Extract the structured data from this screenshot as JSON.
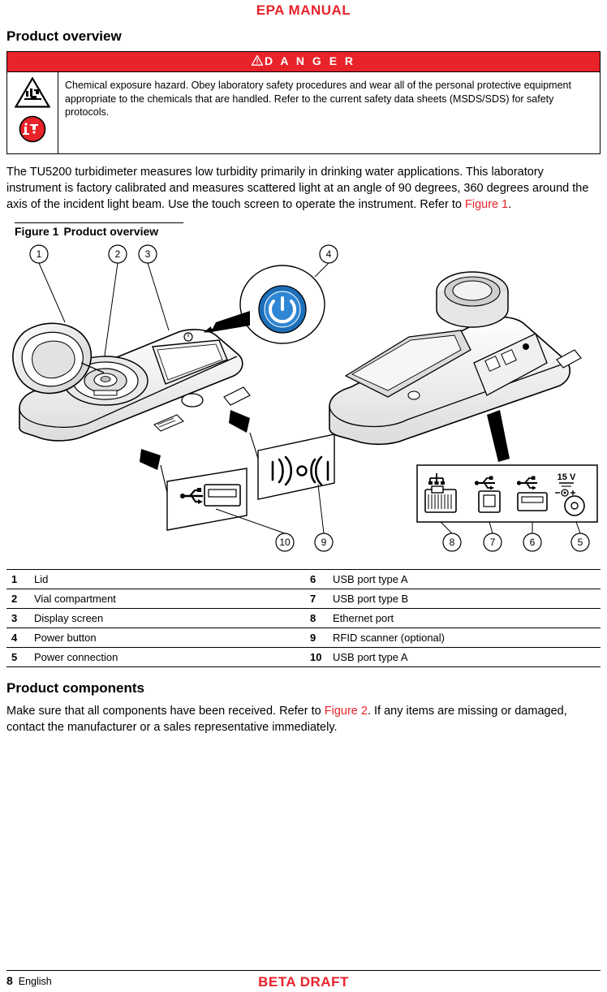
{
  "header": {
    "banner": "EPA MANUAL"
  },
  "footer": {
    "banner": "BETA DRAFT",
    "page_number": "8",
    "language": "English"
  },
  "sections": {
    "product_overview_title": "Product overview",
    "product_components_title": "Product components"
  },
  "danger": {
    "label": "D A N G E R",
    "warning_icon": "warning-triangle-icon",
    "hazard_icons": [
      "chemical-hazard-icon",
      "corrosive-hazard-icon"
    ],
    "text": "Chemical exposure hazard. Obey laboratory safety procedures and wear all of the personal protective equipment appropriate to the chemicals that are handled. Refer to the current safety data sheets (MSDS/SDS) for safety protocols."
  },
  "intro": {
    "part1": "The TU5200 turbidimeter measures low turbidity primarily in drinking water applications. This laboratory instrument is factory calibrated and measures scattered light at an angle of 90 degrees, 360 degrees around the axis of the incident light beam. Use the touch screen to operate the instrument. Refer to ",
    "xref": "Figure 1",
    "part2": "."
  },
  "figure": {
    "caption_num": "Figure 1",
    "caption_title": "Product overview",
    "callouts": [
      "1",
      "2",
      "3",
      "4",
      "5",
      "6",
      "7",
      "8",
      "9",
      "10"
    ],
    "connector_label": "15 V",
    "connector_polarity": "+"
  },
  "legend": {
    "rows": [
      {
        "n1": "1",
        "l1": "Lid",
        "n2": "6",
        "l2": "USB port type A"
      },
      {
        "n1": "2",
        "l1": "Vial compartment",
        "n2": "7",
        "l2": "USB port type B"
      },
      {
        "n1": "3",
        "l1": "Display screen",
        "n2": "8",
        "l2": "Ethernet port"
      },
      {
        "n1": "4",
        "l1": "Power button",
        "n2": "9",
        "l2": "RFID scanner (optional)"
      },
      {
        "n1": "5",
        "l1": "Power connection",
        "n2": "10",
        "l2": "USB port type A"
      }
    ]
  },
  "components": {
    "part1": "Make sure that all components have been received. Refer to ",
    "xref": "Figure 2",
    "part2": ". If any items are missing or damaged, contact the manufacturer or a sales representative immediately."
  },
  "colors": {
    "accent_red": "#e8232a",
    "link_red": "#e8232a",
    "device_blue": "#1c6fb8",
    "line_black": "#000000"
  }
}
